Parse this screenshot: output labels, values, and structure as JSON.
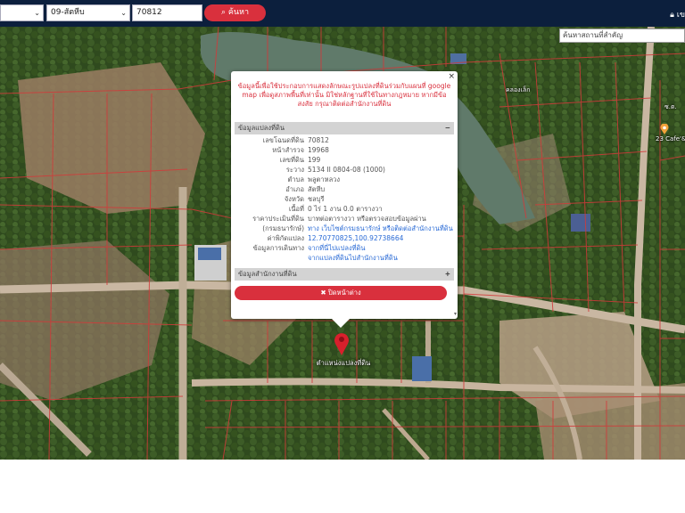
{
  "topbar": {
    "province_select": "",
    "district_select": "09-สัตหีบ",
    "parcel_input": "70812",
    "search_button": "ค้นหา",
    "login_label": "เข"
  },
  "map": {
    "search_placeholder": "ค้นหาสถานที่สำคัญ",
    "poi_labels": [
      "คลองเล็ก",
      "ซ.ต.",
      "23 Cafe'&"
    ],
    "pin_label": "ตำแหน่งแปลงที่ดิน"
  },
  "popup": {
    "close": "×",
    "notice": "ข้อมูลนี้เพื่อใช้ประกอบการแสดงลักษณะรูปแปลงที่ดินร่วมกับแผนที่ google map เพื่อดูสภาพพื้นที่เท่านั้น มิใช่หลักฐานที่ใช้ในทางกฎหมาย หากมีข้อสงสัย กรุณาติดต่อสำนักงานที่ดิน",
    "section_land": "ข้อมูลแปลงที่ดิน",
    "section_land_toggle": "−",
    "rows": [
      {
        "k": "เลขโฉนดที่ดิน",
        "v": "70812"
      },
      {
        "k": "หน้าสำรวจ",
        "v": "19968"
      },
      {
        "k": "เลขที่ดิน",
        "v": "199"
      },
      {
        "k": "ระวาง",
        "v": "5134 II 0804-08 (1000)"
      },
      {
        "k": "ตำบล",
        "v": "พลูตาหลวง"
      },
      {
        "k": "อำเภอ",
        "v": "สัตหีบ"
      },
      {
        "k": "จังหวัด",
        "v": "ชลบุรี"
      },
      {
        "k": "เนื้อที่",
        "v": "0 ไร่ 1 งาน 0.0 ตารางวา"
      },
      {
        "k": "ราคาประเมินที่ดิน",
        "v": "บาทต่อตารางวา หรือตรวจสอบข้อมูลผ่าน"
      },
      {
        "k": "(กรมธนารักษ์)",
        "v": "ทาง เว็บไซต์กรมธนารักษ์ หรือติดต่อสำนักงานที่ดิน"
      },
      {
        "k": "ค่าพิกัดแปลง",
        "v": "12.70770825,100.92738664"
      },
      {
        "k": "ข้อมูลการเดินทาง",
        "v": "จากที่นี่ไปแปลงที่ดิน"
      },
      {
        "k": "",
        "v": "จากแปลงที่ดินไปสำนักงานที่ดิน"
      }
    ],
    "section_office": "ข้อมูลสำนักงานที่ดิน",
    "section_office_toggle": "+",
    "close_button": "✖ ปิดหน้าต่าง"
  }
}
